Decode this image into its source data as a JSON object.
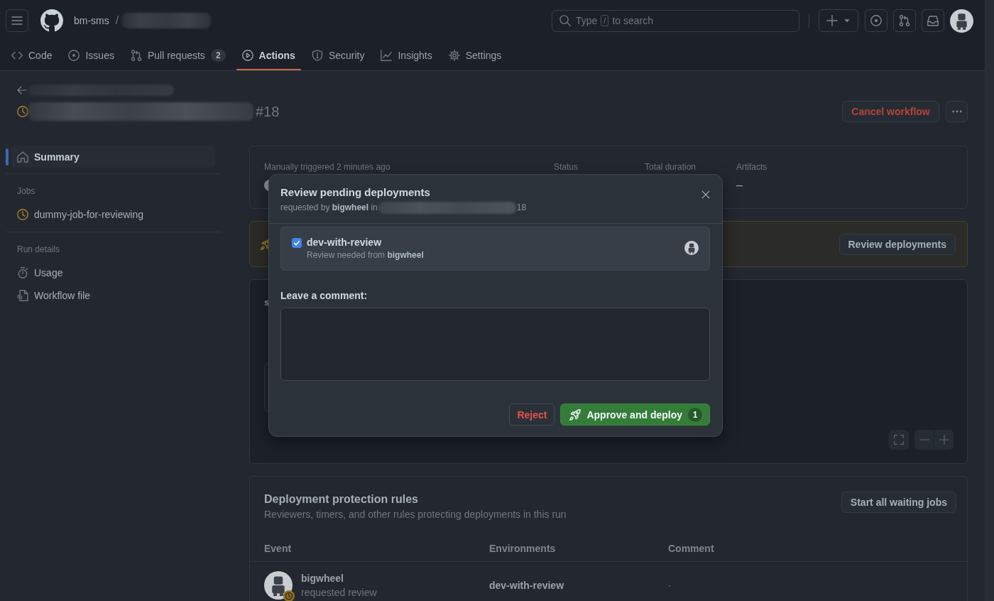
{
  "topbar": {
    "owner": "bm-sms",
    "separator": "/",
    "search": {
      "hint": "Type",
      "shortcut_key": "/",
      "hint_end": "to search"
    }
  },
  "tabs": [
    {
      "label": "Code",
      "selected": false
    },
    {
      "label": "Issues",
      "selected": false
    },
    {
      "label": "Pull requests",
      "counter": "2",
      "selected": false
    },
    {
      "label": "Actions",
      "selected": true
    },
    {
      "label": "Security",
      "selected": false
    },
    {
      "label": "Insights",
      "selected": false
    },
    {
      "label": "Settings",
      "selected": false
    }
  ],
  "run": {
    "number": "#18",
    "cancel_button": "Cancel workflow"
  },
  "sidebar": {
    "summary": {
      "label": "Summary",
      "selected": true
    },
    "sections": [
      {
        "heading": "Jobs",
        "items": [
          {
            "label": "dummy-job-for-reviewing",
            "selected": false
          }
        ]
      },
      {
        "heading": "Run details",
        "items": [
          {
            "label": "Usage",
            "selected": false
          },
          {
            "label": "Workflow file",
            "selected": false
          }
        ]
      }
    ]
  },
  "summary_card": {
    "trigger": "Manually triggered 2 minutes ago",
    "columns": [
      {
        "label": "Status"
      },
      {
        "label": "Total duration"
      },
      {
        "label": "Artifacts",
        "value": "–"
      }
    ]
  },
  "banner": {
    "button": "Review deployments"
  },
  "graph": {
    "title_fragment": "s"
  },
  "protection_rules": {
    "title": "Deployment protection rules",
    "subtitle": "Reviewers, timers, and other rules protecting deployments in this run",
    "button": "Start all waiting jobs",
    "columns": [
      "Event",
      "Environments",
      "Comment"
    ],
    "rows": [
      {
        "user": "bigwheel",
        "action": "requested review",
        "environment": "dev-with-review",
        "comment": "-"
      }
    ]
  },
  "dialog": {
    "title": "Review pending deployments",
    "subtitle": "requested by **bigwheel** in",
    "subtitle_end": "18",
    "environments": [
      {
        "name": "dev-with-review",
        "checked": true,
        "note": "Review needed from **bigwheel**"
      }
    ],
    "comment_label": "Leave a comment:",
    "reject": "Reject",
    "approve": {
      "label": "Approve and deploy",
      "counter": "1"
    }
  }
}
